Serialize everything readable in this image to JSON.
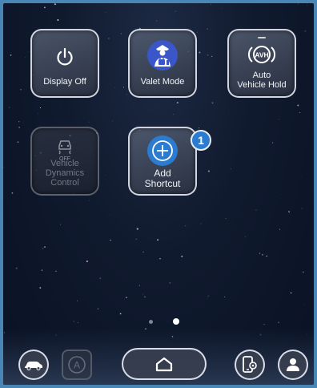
{
  "tiles": [
    {
      "label": "Display Off",
      "icon": "power-icon"
    },
    {
      "label": "Valet Mode",
      "icon": "valet-icon"
    },
    {
      "label_line1": "Auto",
      "label_line2": "Vehicle Hold",
      "icon_text": "AVH",
      "icon": "avh-icon"
    },
    {
      "label_line1": "Vehicle",
      "label_line2": "Dynamics",
      "label_line3": "Control",
      "icon_text": "OFF",
      "icon": "vdc-off-icon",
      "disabled": true
    },
    {
      "label_line1": "Add",
      "label_line2": "Shortcut",
      "icon": "plus-icon"
    }
  ],
  "badge": "1",
  "pagination": {
    "pages": 2,
    "current": 2
  },
  "dock": {
    "items": [
      "car-icon",
      "auto-icon",
      "home-icon",
      "phone-settings-icon",
      "profile-icon"
    ],
    "auto_label": "A"
  },
  "colors": {
    "accent": "#2b7bd0",
    "valet": "#3a56c8",
    "background": "#101a2e"
  }
}
